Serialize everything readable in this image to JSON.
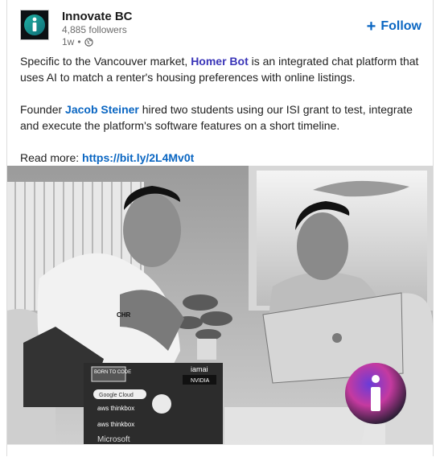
{
  "post": {
    "org_name": "Innovate BC",
    "followers": "4,885 followers",
    "age": "1w",
    "follow_label": "Follow",
    "paragraph1": {
      "before": "Specific to the Vancouver market, ",
      "mention": "Homer Bot",
      "after": " is an integrated chat platform that uses AI to match a renter's housing preferences with online listings."
    },
    "paragraph2": {
      "before": "Founder ",
      "mention": "Jacob Steiner",
      "after": " hired two students using our ISI grant to test, integrate and execute the platform's software features on a short timeline."
    },
    "read_more": {
      "label": "Read more: ",
      "url": "https://bit.ly/2L4Mv0t"
    }
  },
  "photo": {
    "laptop_stickers": [
      "BORN TO CODE",
      "iamai",
      "NVIDIA",
      "Google Cloud",
      "aws thinkbox",
      "aws thinkbox",
      "Microsoft"
    ],
    "shirt_text": "CHR"
  },
  "colors": {
    "link": "#0a66c2",
    "mention": "#3a35b8",
    "follow": "#0a66c2"
  },
  "icons": {
    "logo": "innovate-bc-logo-icon",
    "globe": "globe-icon",
    "plus": "plus-icon"
  }
}
